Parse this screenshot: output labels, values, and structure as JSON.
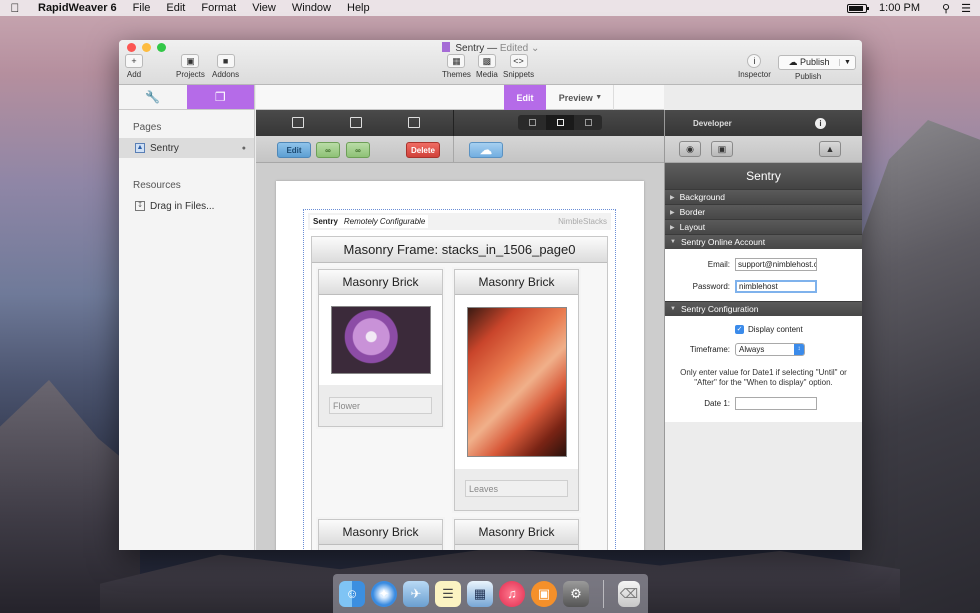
{
  "menubar": {
    "app": "RapidWeaver 6",
    "items": [
      "File",
      "Edit",
      "Format",
      "View",
      "Window",
      "Help"
    ],
    "clock": "1:00 PM"
  },
  "window": {
    "title": "Sentry",
    "title_sep": "—",
    "status": "Edited",
    "toolbar": {
      "add": "Add",
      "projects": "Projects",
      "addons": "Addons",
      "themes": "Themes",
      "media": "Media",
      "snippets": "Snippets",
      "inspector": "Inspector",
      "publish": "Publish",
      "publish_caption": "Publish"
    }
  },
  "sidebar": {
    "pages_heading": "Pages",
    "pages": [
      {
        "label": "Sentry"
      }
    ],
    "resources_heading": "Resources",
    "resources": [
      {
        "label": "Drag in Files..."
      }
    ]
  },
  "modes": {
    "edit": "Edit",
    "preview": "Preview"
  },
  "actions": {
    "edit": "Edit",
    "delete": "Delete"
  },
  "stack": {
    "name": "Sentry",
    "tag": "Remotely Configurable",
    "vendor": "NimbleStacks",
    "frame_title": "Masonry Frame: stacks_in_1506_page0",
    "bricks": [
      {
        "title": "Masonry Brick",
        "caption": "Flower"
      },
      {
        "title": "Masonry Brick",
        "caption": "Leaves"
      },
      {
        "title": "Masonry Brick"
      },
      {
        "title": "Masonry Brick"
      }
    ]
  },
  "inspector": {
    "tab": "Developer",
    "title": "Sentry",
    "sections": {
      "background": "Background",
      "border": "Border",
      "layout": "Layout",
      "account": "Sentry Online Account",
      "config": "Sentry Configuration"
    },
    "account": {
      "email_label": "Email:",
      "email_value": "support@nimblehost.c",
      "password_label": "Password:",
      "password_value": "nimblehost"
    },
    "config": {
      "display_label": "Display content",
      "timeframe_label": "Timeframe:",
      "timeframe_value": "Always",
      "note": "Only enter value for Date1 if selecting \"Until\" or \"After\" for the \"When to display\" option.",
      "date1_label": "Date 1:"
    }
  }
}
